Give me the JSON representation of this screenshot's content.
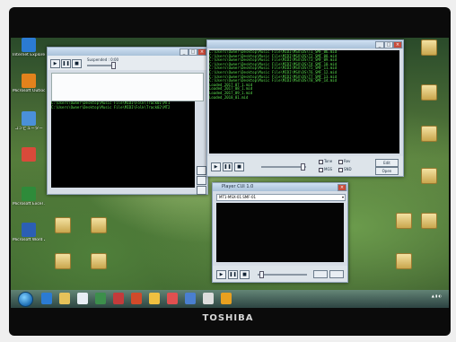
{
  "brand": "TOSHIBA",
  "desktop_icons_left": [
    {
      "label": "Internet Explorer",
      "name": "internet-explorer-icon",
      "color": "#2b7bd3"
    },
    {
      "label": "Microsoft Outlook 2010",
      "name": "outlook-icon",
      "color": "#e2821c"
    },
    {
      "label": "コンピューター",
      "name": "computer-icon",
      "color": "#4a90d9"
    },
    {
      "label": "",
      "name": "person-app-icon",
      "color": "#d94a3a"
    },
    {
      "label": "Microsoft Excel 2010",
      "name": "excel-icon",
      "color": "#2e8b3a"
    },
    {
      "label": "Microsoft Word 2010",
      "name": "word-icon",
      "color": "#2b5fb4"
    }
  ],
  "desktop_icons_right": [
    {
      "label": "",
      "name": "folder-icon"
    },
    {
      "label": "",
      "name": "folder-icon"
    },
    {
      "label": "",
      "name": "folder-icon"
    },
    {
      "label": "",
      "name": "folder-icon"
    },
    {
      "label": "",
      "name": "folder-icon"
    },
    {
      "label": "",
      "name": "folder-icon"
    },
    {
      "label": "",
      "name": "folder-icon"
    }
  ],
  "window_left": {
    "status_text": "Suspended : 0:00",
    "console_lines": [
      "C:\\Users\\Owner\\Desktop\\Music File\\MIDI\\Folk\\Track01\\MT1",
      "C:\\Users\\Owner\\Desktop\\Music File\\MIDI\\Folk\\Track02\\MT2"
    ]
  },
  "window_console": {
    "lines": [
      "C:\\Users\\Owner\\Desktop\\Music File\\MIDI\\MSX\\DS\\T1_SMF_06.mid",
      "C:\\Users\\Owner\\Desktop\\Music File\\MIDI\\MSX\\DS\\T2_SMF_08.mid",
      "C:\\Users\\Owner\\Desktop\\Music File\\MIDI\\MSX\\DS\\T3_SMF_09.mid",
      "C:\\Users\\Owner\\Desktop\\Music File\\MIDI\\MSX\\DS\\T4_SMF_10.mid",
      "C:\\Users\\Owner\\Desktop\\Music File\\MIDI\\MSX\\DS\\T5_SMF_11.mid",
      "C:\\Users\\Owner\\Desktop\\Music File\\MIDI\\MSX\\DS\\T6_SMF_12.mid",
      "C:\\Users\\Owner\\Desktop\\Music File\\MIDI\\MSX\\DS\\T7_SMF_13.mid",
      "C:\\Users\\Owner\\Desktop\\Music File\\MIDI\\MSX\\DS\\T8_SMF_14.mid",
      "Loaded_2017_07_1.mid",
      "Loaded_2017_08_1.mid",
      "Loaded_2017_09_1.mid",
      "Loaded_2018_01.mid"
    ],
    "checkbox_labels": [
      "Tone",
      "Rev",
      "MGS",
      "SND"
    ],
    "right_buttons": [
      "Edit",
      "Open"
    ]
  },
  "window_small": {
    "title": "Player CUI 1.0",
    "dropdown_value": "MT1-MSX-01.SMF-01"
  },
  "taskbar": {
    "apps": [
      {
        "name": "ie-taskbar-icon",
        "color": "#2b7bd3"
      },
      {
        "name": "explorer-taskbar-icon",
        "color": "#e6c25a"
      },
      {
        "name": "media-taskbar-icon",
        "color": "#e8eef5"
      },
      {
        "name": "app-taskbar-icon-1",
        "color": "#3c8f4b"
      },
      {
        "name": "app-taskbar-icon-2",
        "color": "#c33b3b"
      },
      {
        "name": "app-taskbar-icon-3",
        "color": "#d14a2a"
      },
      {
        "name": "app-taskbar-icon-4",
        "color": "#f0c040"
      },
      {
        "name": "app-taskbar-icon-5",
        "color": "#e05050"
      },
      {
        "name": "app-taskbar-icon-6",
        "color": "#4a7fd0"
      },
      {
        "name": "app-taskbar-icon-7",
        "color": "#dddddd"
      },
      {
        "name": "app-taskbar-icon-8",
        "color": "#e8a020"
      }
    ]
  }
}
